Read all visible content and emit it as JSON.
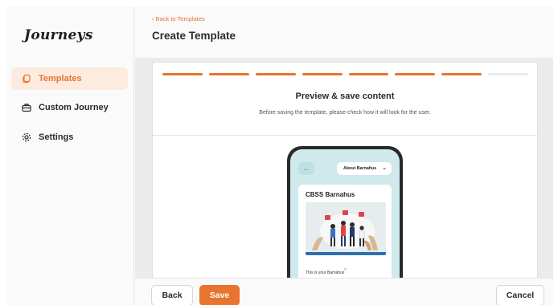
{
  "app": {
    "logo": "Journeys"
  },
  "sidebar": {
    "items": [
      {
        "label": "Templates",
        "icon": "templates-icon",
        "active": true
      },
      {
        "label": "Custom Journey",
        "icon": "briefcase-icon",
        "active": false
      },
      {
        "label": "Settings",
        "icon": "gear-icon",
        "active": false
      }
    ]
  },
  "header": {
    "back_link": "Back to Templates",
    "title": "Create Template"
  },
  "wizard": {
    "steps_total": 8,
    "steps_completed": 7,
    "title": "Preview & save content",
    "description": "Before saving the template, please check how it will look for the user."
  },
  "preview": {
    "dropdown_value": "About Barnahus",
    "card_title": "CBSS Barnahus",
    "card_text": "This is your Barnahus"
  },
  "footer": {
    "back_label": "Back",
    "save_label": "Save",
    "cancel_label": "Cancel"
  },
  "colors": {
    "accent": "#e8742f",
    "accent_light": "#fdebdf",
    "phone_screen": "#cfe9ec"
  }
}
